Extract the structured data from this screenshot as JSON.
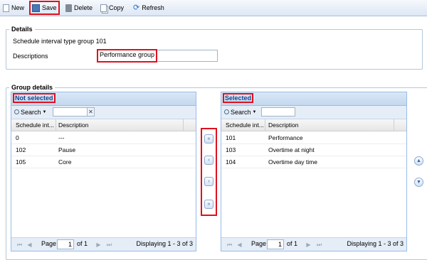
{
  "toolbar": {
    "new_label": "New",
    "save_label": "Save",
    "delete_label": "Delete",
    "copy_label": "Copy",
    "refresh_label": "Refresh"
  },
  "details": {
    "legend": "Details",
    "type_text": "Schedule interval type group 101",
    "descriptions_label": "Descriptions",
    "descriptions_value": "Performance group"
  },
  "group_details": {
    "legend": "Group details",
    "not_selected": {
      "title": "Not selected",
      "search_label": "Search",
      "columns": [
        "Schedule int...",
        "Description"
      ],
      "rows": [
        [
          "0",
          "---"
        ],
        [
          "102",
          "Pause"
        ],
        [
          "105",
          "Core"
        ]
      ],
      "pager": {
        "page_label": "Page",
        "page_value": "1",
        "of_label": "of 1",
        "status": "Displaying 1 - 3 of 3"
      }
    },
    "selected": {
      "title": "Selected",
      "search_label": "Search",
      "columns": [
        "Schedule int...",
        "Description"
      ],
      "rows": [
        [
          "101",
          "Performance"
        ],
        [
          "103",
          "Overtime at night"
        ],
        [
          "104",
          "Overtime day time"
        ]
      ],
      "pager": {
        "page_label": "Page",
        "page_value": "1",
        "of_label": "of 1",
        "status": "Displaying 1 - 3 of 3"
      }
    },
    "move_buttons": [
      "move-all-left-icon",
      "move-left-icon",
      "move-right-icon",
      "move-all-right-icon"
    ],
    "order_buttons": [
      "move-up-icon",
      "move-down-icon"
    ]
  },
  "colors": {
    "highlight": "#e0101e",
    "panel_title": "#15428b",
    "panel_border": "#99bbe8"
  }
}
